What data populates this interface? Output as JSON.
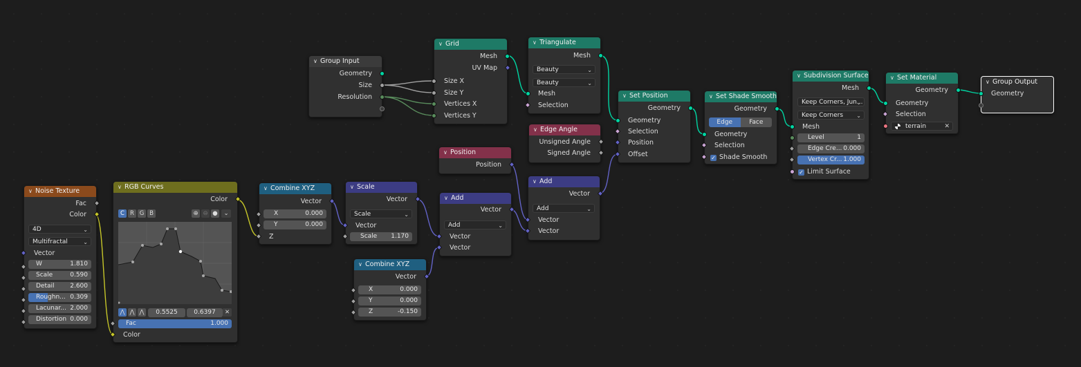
{
  "nodes": {
    "noise_texture": {
      "title": "Noise Texture",
      "outputs": [
        "Fac",
        "Color"
      ],
      "dimensions": "4D",
      "type": "Multifractal",
      "vector_label": "Vector",
      "fields": [
        {
          "label": "W",
          "value": "1.810"
        },
        {
          "label": "Scale",
          "value": "0.590"
        },
        {
          "label": "Detail",
          "value": "2.600"
        },
        {
          "label": "Roughn...",
          "value": "0.309"
        },
        {
          "label": "Lacunar...",
          "value": "2.000"
        },
        {
          "label": "Distortion",
          "value": "0.000"
        }
      ]
    },
    "rgb_curves": {
      "title": "RGB Curves",
      "output": "Color",
      "channels": [
        "C",
        "R",
        "G",
        "B"
      ],
      "point_x": "0.5525",
      "point_y": "0.6397",
      "fac_label": "Fac",
      "fac_value": "1.000",
      "color_label": "Color"
    },
    "combine_xyz_1": {
      "title": "Combine XYZ",
      "output": "Vector",
      "x_label": "X",
      "x_value": "0.000",
      "y_label": "Y",
      "y_value": "0.000",
      "z_label": "Z"
    },
    "scale": {
      "title": "Scale",
      "output": "Vector",
      "operation": "Scale",
      "vector_label": "Vector",
      "scale_label": "Scale",
      "scale_value": "1.170"
    },
    "combine_xyz_2": {
      "title": "Combine XYZ",
      "output": "Vector",
      "x_label": "X",
      "x_value": "0.000",
      "y_label": "Y",
      "y_value": "0.000",
      "z_label": "Z",
      "z_value": "-0.150"
    },
    "add_1": {
      "title": "Add",
      "output": "Vector",
      "operation": "Add",
      "inputs": [
        "Vector",
        "Vector"
      ]
    },
    "position": {
      "title": "Position",
      "output": "Position"
    },
    "add_2": {
      "title": "Add",
      "output": "Vector",
      "operation": "Add",
      "inputs": [
        "Vector",
        "Vector"
      ]
    },
    "group_input": {
      "title": "Group Input",
      "outputs": [
        "Geometry",
        "Size",
        "Resolution"
      ]
    },
    "grid": {
      "title": "Grid",
      "outputs": [
        "Mesh",
        "UV Map"
      ],
      "inputs": [
        "Size X",
        "Size Y",
        "Vertices X",
        "Vertices Y"
      ]
    },
    "triangulate": {
      "title": "Triangulate",
      "output": "Mesh",
      "quad_method": "Beauty",
      "ngon_method": "Beauty",
      "inputs": [
        "Mesh",
        "Selection"
      ]
    },
    "edge_angle": {
      "title": "Edge Angle",
      "outputs": [
        "Unsigned Angle",
        "Signed Angle"
      ]
    },
    "set_position": {
      "title": "Set Position",
      "output": "Geometry",
      "inputs": [
        "Geometry",
        "Selection",
        "Position",
        "Offset"
      ]
    },
    "set_shade_smooth": {
      "title": "Set Shade Smooth",
      "output": "Geometry",
      "domain_options": [
        "Edge",
        "Face"
      ],
      "domain_selected": "Edge",
      "inputs": [
        "Geometry",
        "Selection"
      ],
      "shade_smooth_label": "Shade Smooth",
      "shade_smooth_checked": true
    },
    "subdivision_surface": {
      "title": "Subdivision Surface",
      "output": "Mesh",
      "uv_smooth": "Keep Corners, Jun...",
      "boundary_smooth": "Keep Corners",
      "mesh_label": "Mesh",
      "level_label": "Level",
      "level_value": "1",
      "edge_crease_label": "Edge Cre...",
      "edge_crease_value": "0.000",
      "vertex_crease_label": "Vertex Cr...",
      "vertex_crease_value": "1.000",
      "limit_surface_label": "Limit Surface",
      "limit_surface_checked": true
    },
    "set_material": {
      "title": "Set Material",
      "output": "Geometry",
      "inputs": [
        "Geometry",
        "Selection"
      ],
      "material": "terrain"
    },
    "group_output": {
      "title": "Group Output",
      "input": "Geometry"
    }
  },
  "colors": {
    "geometry_socket": "#00d6a3",
    "float_socket": "#a1a1a1",
    "integer_socket": "#598c5c",
    "vector_socket": "#6363c7",
    "color_socket": "#c7c729",
    "boolean_socket": "#cca6d6",
    "material_socket": "#eb7582",
    "geometry_header": "#1e7a66",
    "texture_header": "#8b4a1c",
    "color_header": "#6e6e1e",
    "vector_header": "#3c3c83",
    "converter_header": "#1f5f80",
    "input_header": "#83314a",
    "selection_highlight": "#4772b3"
  }
}
